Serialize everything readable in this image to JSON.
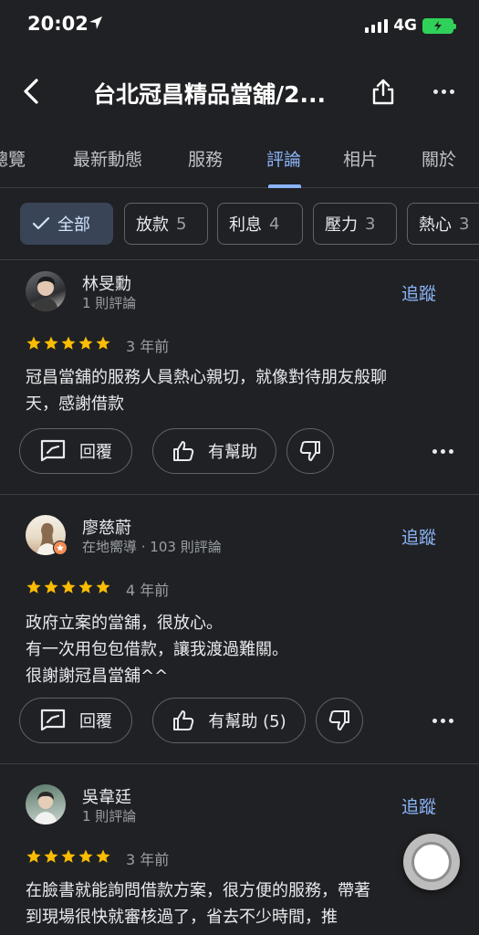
{
  "status_bar": {
    "time": "20:02",
    "network": "4G"
  },
  "header": {
    "title": "台北冠昌精品當舖/2..."
  },
  "tabs": [
    {
      "label": "總覽"
    },
    {
      "label": "最新動態"
    },
    {
      "label": "服務"
    },
    {
      "label": "評論",
      "active": true
    },
    {
      "label": "相片"
    },
    {
      "label": "關於"
    }
  ],
  "chips": [
    {
      "label": "全部",
      "count": "",
      "selected": true
    },
    {
      "label": "放款",
      "count": "5"
    },
    {
      "label": "利息",
      "count": "4"
    },
    {
      "label": "壓力",
      "count": "3"
    },
    {
      "label": "熱心",
      "count": "3"
    }
  ],
  "follow_label": "追蹤",
  "reply_label": "回覆",
  "reviews": [
    {
      "name": "林旻勳",
      "meta": "1 則評論",
      "rating": 5,
      "age": "3 年前",
      "text_lines": [
        "冠昌當舖的服務人員熱心親切，就像對待朋友般聊",
        "天，感謝借款"
      ],
      "helpful_label": "有幫助"
    },
    {
      "name": "廖慈蔚",
      "meta": "在地嚮導 · 103 則評論",
      "rating": 5,
      "age": "4 年前",
      "text_lines": [
        "政府立案的當舖，很放心。",
        "有一次用包包借款，讓我渡過難關。",
        "很謝謝冠昌當舖^^"
      ],
      "helpful_label": "有幫助 (5)"
    },
    {
      "name": "吳韋廷",
      "meta": "1 則評論",
      "rating": 5,
      "age": "3 年前",
      "text_lines": [
        "在臉書就能詢問借款方案，很方便的服務，帶著",
        "到現場很快就審核過了，省去不少時間，推"
      ]
    }
  ],
  "colors": {
    "accent": "#8ab4f8",
    "star": "#fbbc04",
    "background": "#202124"
  },
  "icons": [
    "location-arrow-icon",
    "back-arrow-icon",
    "share-icon",
    "more-icon",
    "check-icon",
    "reply-icon",
    "thumb-up-icon",
    "thumb-down-icon"
  ]
}
